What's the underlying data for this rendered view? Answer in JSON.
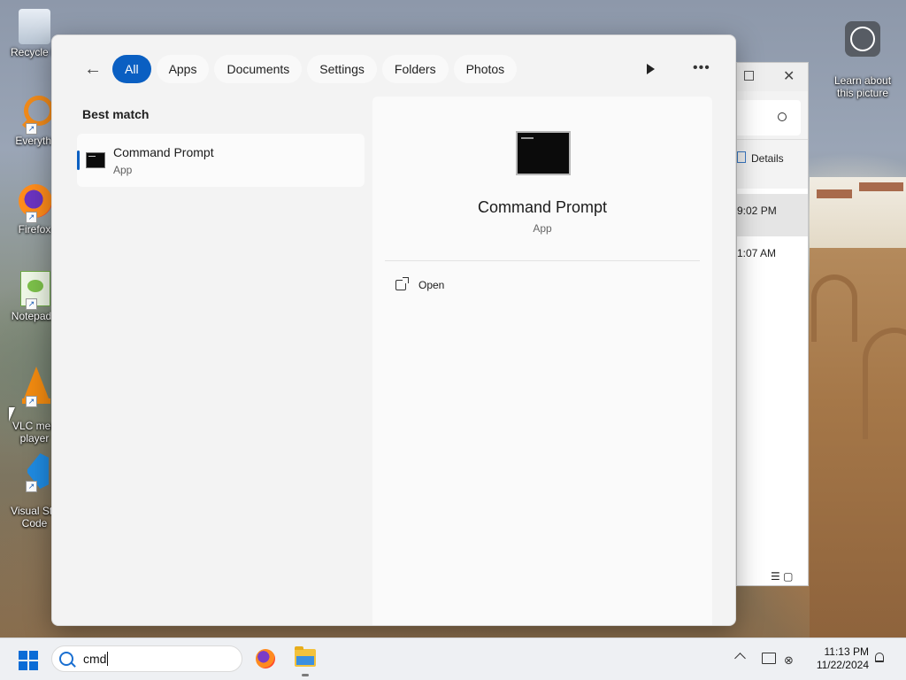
{
  "desktop": {
    "icons": [
      {
        "label": "Recycle B",
        "icon": "recycle-bin-icon"
      },
      {
        "label": "Everythi",
        "icon": "everything-search-icon"
      },
      {
        "label": "Firefox",
        "icon": "firefox-icon"
      },
      {
        "label": "Notepad+",
        "icon": "notepad-plus-plus-icon"
      },
      {
        "label": "VLC med\nplayer",
        "icon": "vlc-icon"
      },
      {
        "label": "Visual Stu\nCode",
        "icon": "vscode-icon"
      }
    ],
    "learn_about": "Learn about\nthis picture"
  },
  "explorer": {
    "details_label": "Details",
    "rows": [
      "9:02 PM",
      "1:07 AM"
    ]
  },
  "search_panel": {
    "tabs": [
      "All",
      "Apps",
      "Documents",
      "Settings",
      "Folders",
      "Photos"
    ],
    "active_tab": "All",
    "best_match_label": "Best match",
    "result": {
      "name": "Command Prompt",
      "type": "App"
    },
    "detail": {
      "title": "Command Prompt",
      "subtitle": "App",
      "action_open": "Open"
    }
  },
  "taskbar": {
    "search_query": "cmd",
    "time": "11:13 PM",
    "date": "11/22/2024"
  },
  "colors": {
    "accent": "#0a5fc2",
    "panel_bg": "#f3f3f3",
    "taskbar_bg": "#eef0f3"
  }
}
